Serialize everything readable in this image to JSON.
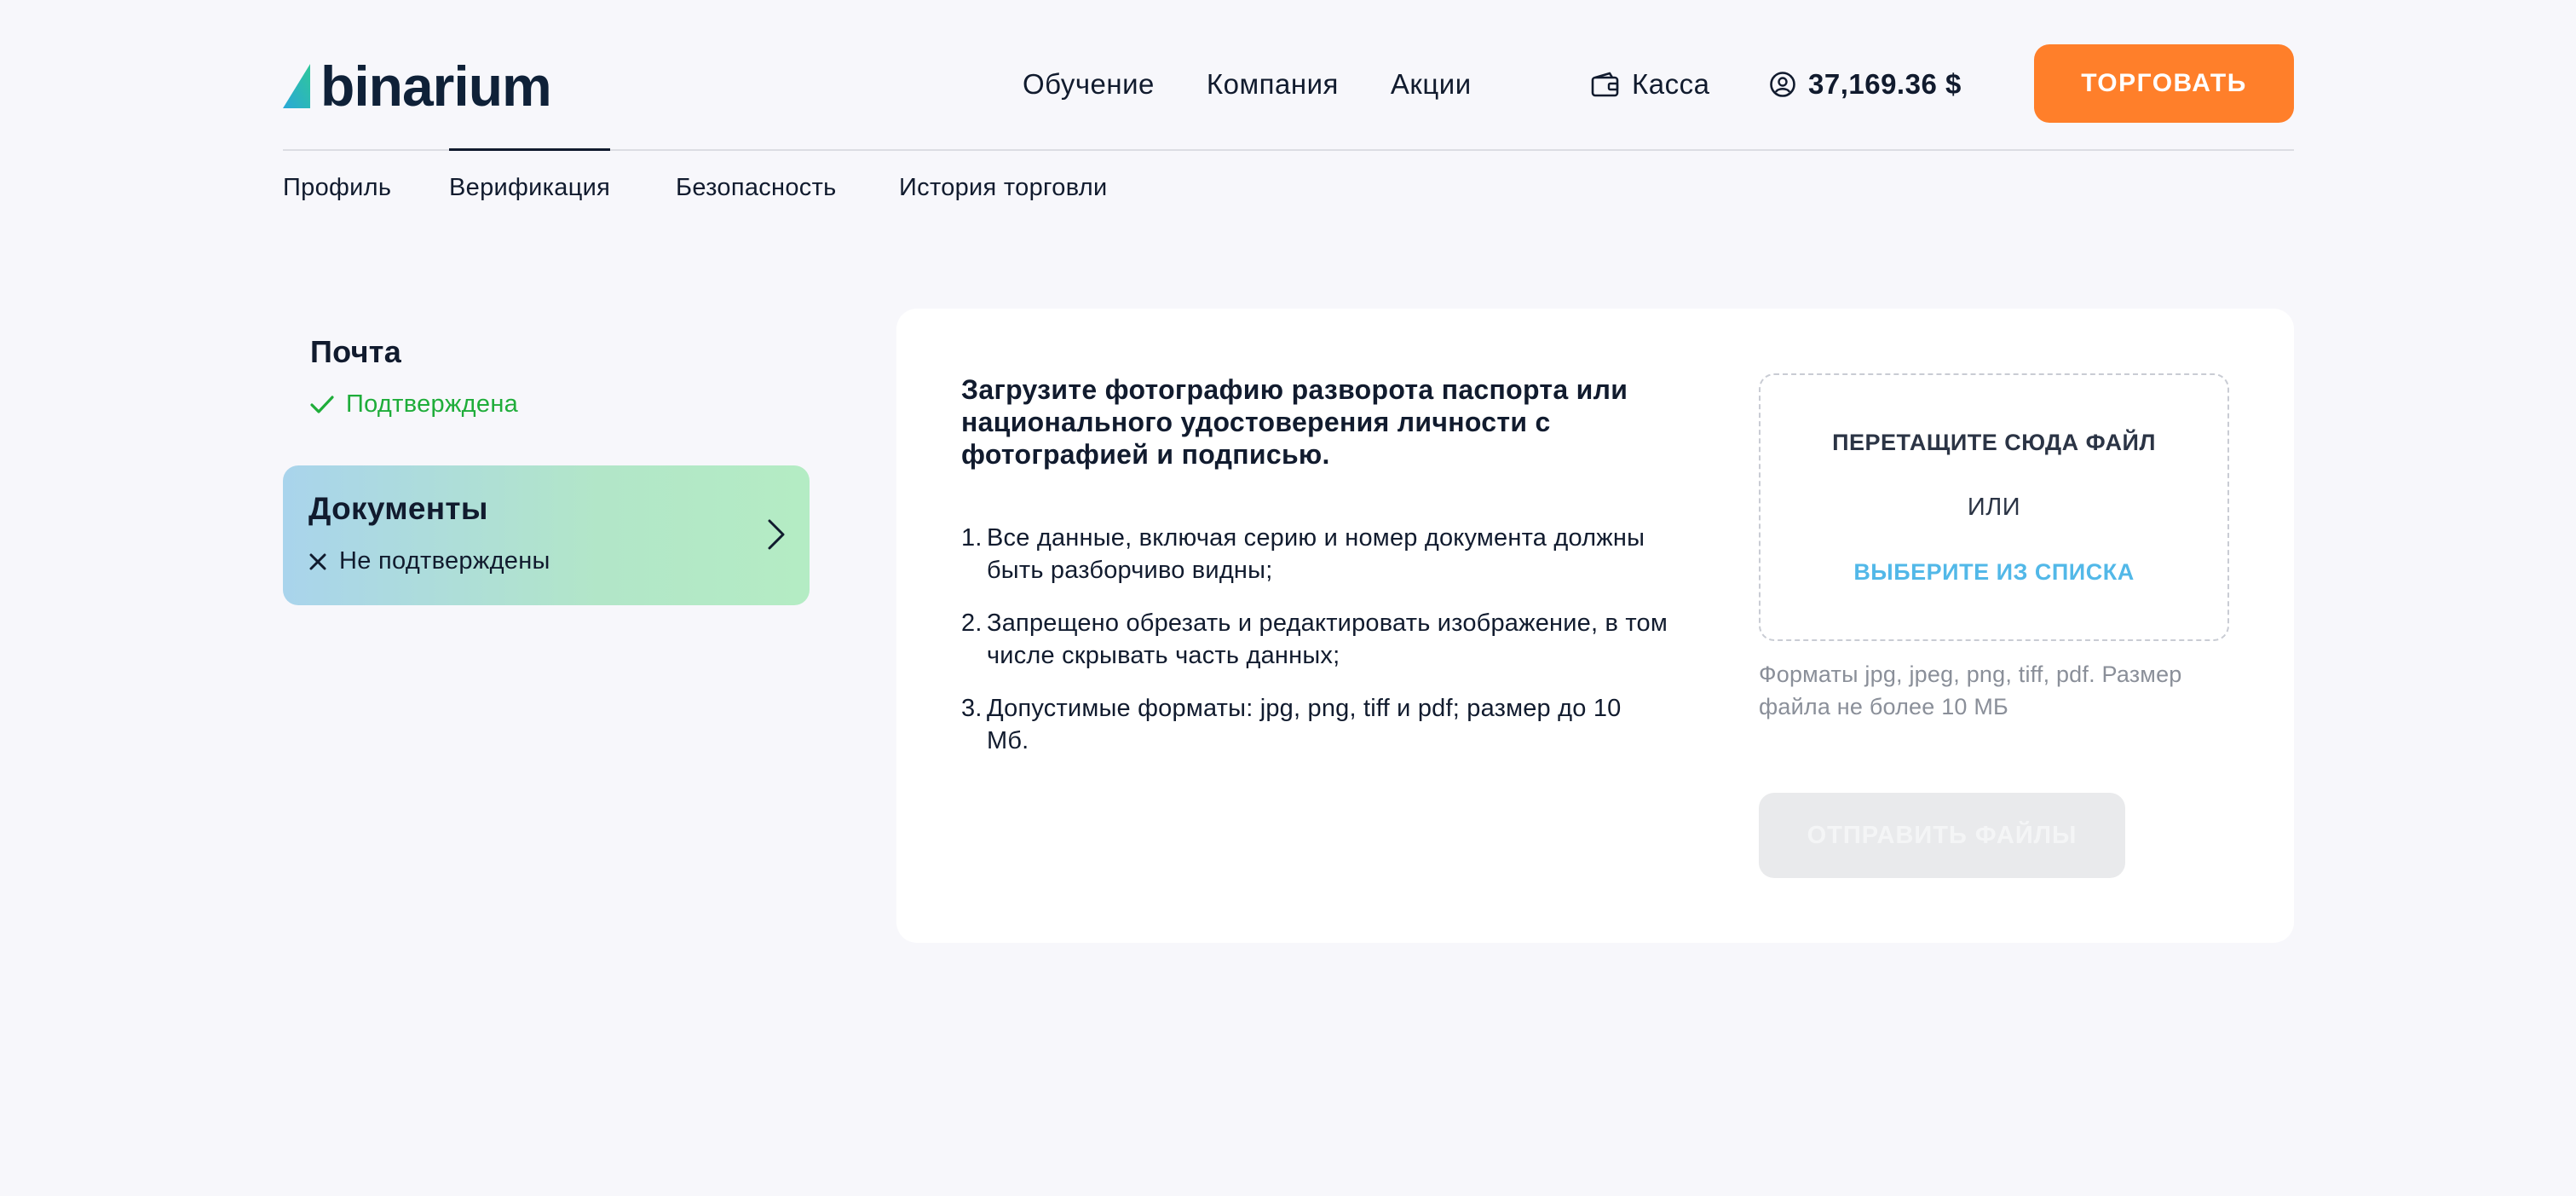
{
  "header": {
    "logo_text": "binarium",
    "nav": [
      "Обучение",
      "Компания",
      "Акции"
    ],
    "cash_label": "Касса",
    "balance": "37,169.36 $",
    "trade_button": "ТОРГОВАТЬ"
  },
  "tabs": [
    {
      "label": "Профиль",
      "active": false
    },
    {
      "label": "Верификация",
      "active": true
    },
    {
      "label": "Безопасность",
      "active": false
    },
    {
      "label": "История торговли",
      "active": false
    }
  ],
  "sidebar": {
    "email": {
      "title": "Почта",
      "status": "Подтверждена"
    },
    "documents": {
      "title": "Документы",
      "status": "Не подтверждены"
    }
  },
  "main": {
    "title": "Загрузите фотографию разворота паспорта или национального удостоверения личности с фотографией и подписью.",
    "rules": [
      {
        "num": "1.",
        "text": "Все данные, включая серию и номер документа должны быть разборчиво видны;"
      },
      {
        "num": "2.",
        "text": "Запрещено обрезать и редактировать изображение, в том числе скрывать часть данных;"
      },
      {
        "num": "3.",
        "text": "Допустимые форматы: jpg, png, tiff и pdf; размер до 10 Мб."
      }
    ],
    "dropzone": {
      "title": "ПЕРЕТАЩИТЕ СЮДА ФАЙЛ",
      "or": "ИЛИ",
      "choose": "ВЫБЕРИТЕ ИЗ СПИСКА"
    },
    "formats_note": "Форматы jpg, jpeg, png, tiff, pdf. Размер файла не более 10 МБ",
    "submit_button": "ОТПРАВИТЬ ФАЙЛЫ"
  },
  "colors": {
    "accent_orange": "#ff7f2a",
    "success_green": "#1fad3a",
    "link_blue": "#52b8e8",
    "logo_dark": "#0f2138"
  },
  "icons": {
    "wallet": "wallet-icon",
    "user": "user-circle-icon",
    "check": "check-icon",
    "cross": "close-icon",
    "chevron": "chevron-right-icon"
  }
}
